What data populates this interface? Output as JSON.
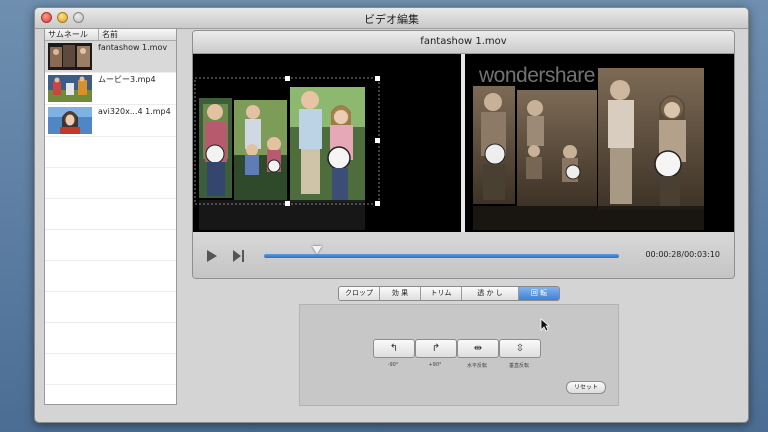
{
  "window": {
    "title": "ビデオ編集"
  },
  "file_list": {
    "columns": {
      "thumbnail": "サムネール",
      "name": "名前"
    },
    "items": [
      {
        "name": "fantashow 1.mov"
      },
      {
        "name": "ムービー3.mp4"
      },
      {
        "name": "avi320x...4 1.mp4"
      }
    ]
  },
  "preview": {
    "title": "fantashow 1.mov",
    "watermark": "wondershare",
    "timecode": "00:00:28/00:03:10",
    "playback_progress": 0.15
  },
  "tabs": [
    {
      "label": "クロップ"
    },
    {
      "label": "効 果"
    },
    {
      "label": "トリム"
    },
    {
      "label": "透 か し"
    },
    {
      "label": "回 転"
    }
  ],
  "rotate": {
    "buttons": [
      {
        "label": "-90°",
        "icon": "rotate-left-icon",
        "glyph": "↰"
      },
      {
        "label": "+90°",
        "icon": "rotate-right-icon",
        "glyph": "↱"
      },
      {
        "label": "水平反転",
        "icon": "flip-horizontal-icon",
        "glyph": "⇹"
      },
      {
        "label": "垂直反転",
        "icon": "flip-vertical-icon",
        "glyph": "⇳"
      }
    ],
    "reset_label": "リセット"
  },
  "colors": {
    "accent": "#3f82d6",
    "seek_bar": "#2d6fc0",
    "desktop": "#5a7ba0"
  }
}
